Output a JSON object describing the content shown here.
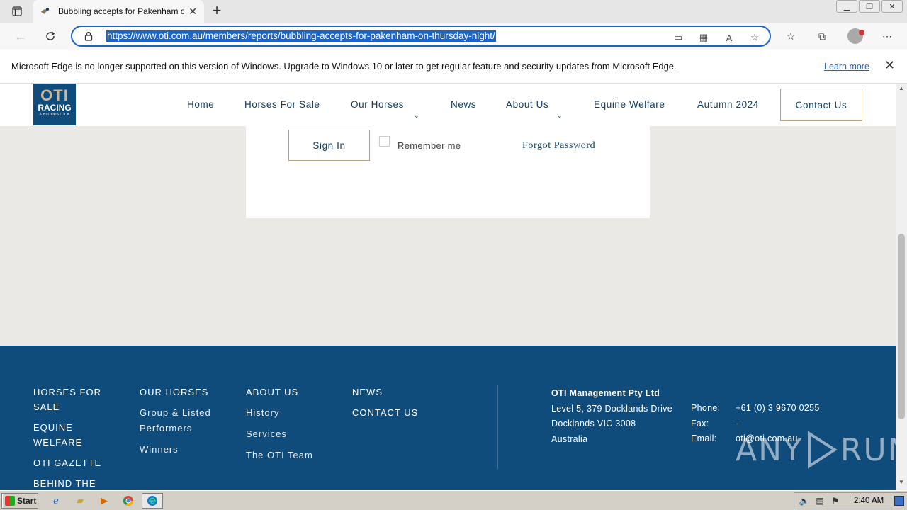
{
  "browser": {
    "tab_title": "Bubbling accepts for Pakenham on Thursday night",
    "url": "https://www.oti.com.au/members/reports/bubbling-accepts-for-pakenham-on-thursday-night/",
    "infobar_message": "Microsoft Edge is no longer supported on this version of Windows. Upgrade to Windows 10 or later to get regular feature and security updates from Microsoft Edge.",
    "infobar_link": "Learn more"
  },
  "site": {
    "logo": {
      "line1": "OTI",
      "line2": "RACING",
      "line3": "& BLOODSTOCK"
    },
    "nav": [
      {
        "label": "Home"
      },
      {
        "label": "Horses For Sale"
      },
      {
        "label": "Our Horses"
      },
      {
        "label": "News"
      },
      {
        "label": "About Us"
      },
      {
        "label": "Equine Welfare"
      },
      {
        "label": "Autumn 2024"
      }
    ],
    "contact_button": "Contact Us"
  },
  "login": {
    "signin_label": "Sign In",
    "remember_label": "Remember me",
    "forgot_label": "Forgot Password"
  },
  "footer": {
    "col1": {
      "head1": "HORSES FOR SALE",
      "head2": "EQUINE WELFARE",
      "head3": "OTI GAZETTE",
      "head4": "BEHIND THE"
    },
    "col2": {
      "head": "OUR HORSES",
      "links": [
        "Group & Listed Performers",
        "Winners"
      ]
    },
    "col3": {
      "head": "ABOUT US",
      "links": [
        "History",
        "Services",
        "The OTI Team"
      ]
    },
    "col4": {
      "head1": "NEWS",
      "head2": "CONTACT US"
    },
    "company": {
      "name": "OTI Management Pty Ltd",
      "address1": "Level 5, 379 Docklands Drive",
      "address2": "Docklands VIC 3008",
      "country": "Australia"
    },
    "contact": {
      "phone_label": "Phone:",
      "phone": "+61 (0) 3 9670 0255",
      "fax_label": "Fax:",
      "fax": "-",
      "email_label": "Email:",
      "email": "oti@oti.com.au"
    },
    "watermark": {
      "left": "ANY",
      "right": "RUN"
    }
  },
  "taskbar": {
    "start_label": "Start",
    "clock": "2:40 AM"
  },
  "colors": {
    "brand_navy": "#0f4b7b",
    "brand_gold": "#b3a27c",
    "edge_blue": "#1a64c8"
  }
}
